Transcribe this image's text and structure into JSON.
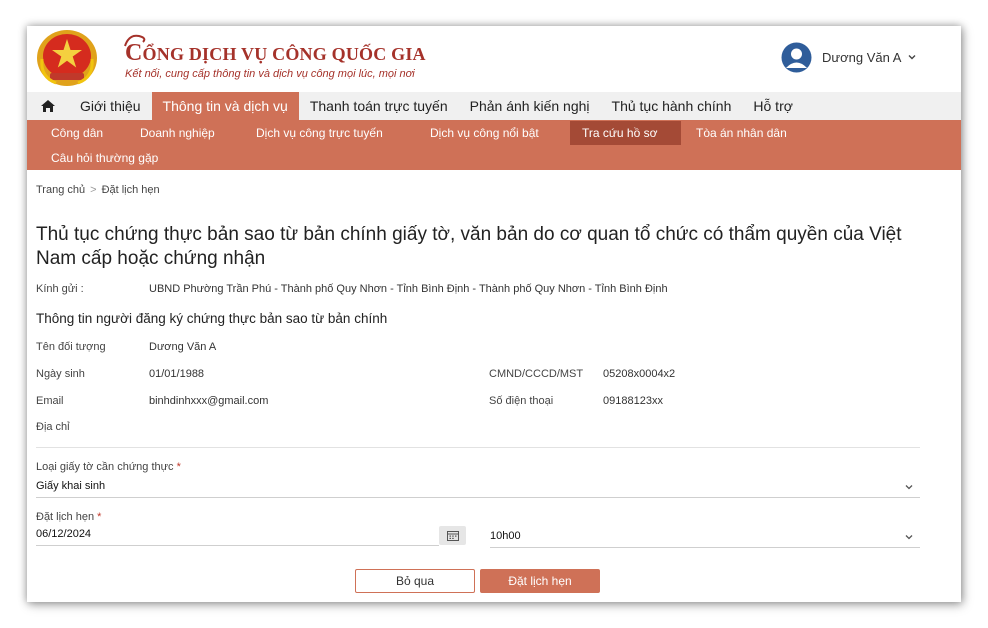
{
  "header": {
    "brand_first_letter": "C",
    "brand_rest": "ỔNG DỊCH VỤ CÔNG QUỐC GIA",
    "slogan": "Kết nối, cung cấp thông tin và dịch vụ công mọi lúc, mọi nơi",
    "user_name": "Dương Văn A"
  },
  "main_nav": [
    "Giới thiệu",
    "Thông tin và dịch vụ",
    "Thanh toán trực tuyến",
    "Phản ánh kiến nghị",
    "Thủ tục hành chính",
    "Hỗ trợ"
  ],
  "sub_nav": [
    "Công dân",
    "Doanh nghiệp",
    "Dịch vụ công trực tuyến",
    "Dịch vụ công nổi bật",
    "Tra cứu hồ sơ",
    "Tòa án nhân dân",
    "Câu hỏi thường gặp"
  ],
  "breadcrumb": {
    "home": "Trang chủ",
    "sep": ">",
    "current": "Đặt lịch hẹn"
  },
  "title": "Thủ tục chứng thực bản sao từ bản chính giấy tờ, văn bản do cơ quan tổ chức có thẩm quyền của Việt Nam cấp hoặc chứng nhận",
  "recipient": {
    "label": "Kính gửi :",
    "value": "UBND Phường Trần Phú - Thành phố Quy Nhơn - Tỉnh Bình Định - Thành phố Quy Nhơn - Tỉnh Bình Định"
  },
  "section_title": "Thông tin người đăng ký chứng thực bản sao từ bản chính",
  "person": {
    "name_label": "Tên đối tượng",
    "name": "Dương Văn A",
    "dob_label": "Ngày sinh",
    "dob": "01/01/1988",
    "id_label": "CMND/CCCD/MST",
    "id": "05208x0004x2",
    "email_label": "Email",
    "email": "binhdinhxxx@gmail.com",
    "phone_label": "Số điện thoại",
    "phone": "09188123xx",
    "address_label": "Địa chỉ"
  },
  "form": {
    "doc_type_label": "Loại giấy tờ cần chứng thực",
    "doc_type_value": "Giấy khai sinh",
    "appointment_label": "Đặt lịch hẹn",
    "date_value": "06/12/2024",
    "time_value": "10h00",
    "required_mark": "*"
  },
  "buttons": {
    "skip": "Bỏ qua",
    "book": "Đặt lịch hẹn"
  },
  "colors": {
    "accent": "#cf7157",
    "accent_dark": "#a44a36",
    "brand_red": "#a5322a",
    "nav_bg": "#f0f0f0"
  }
}
